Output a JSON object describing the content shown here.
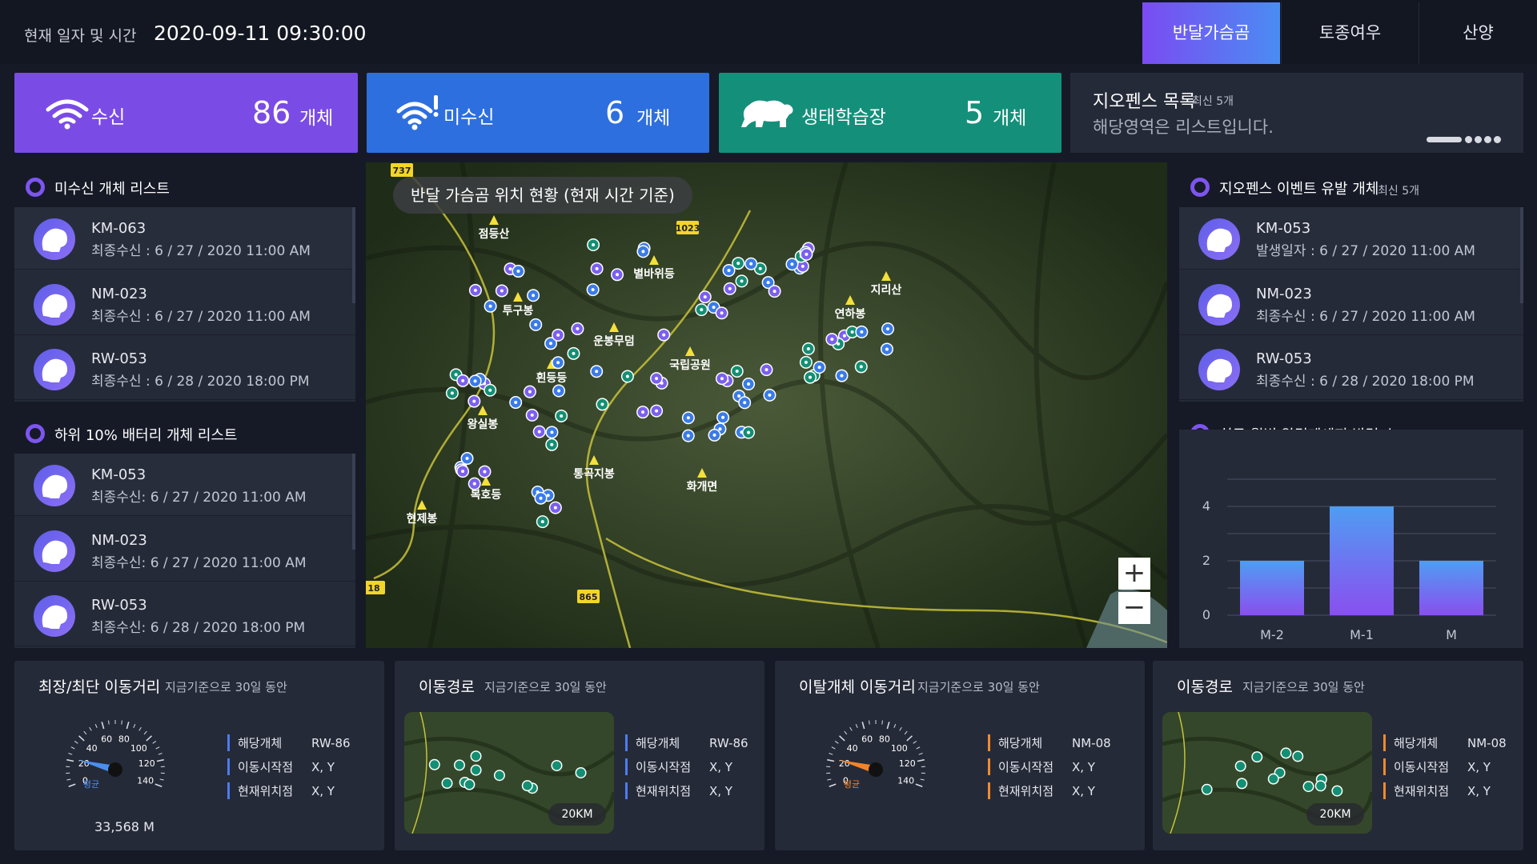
{
  "header": {
    "datetime_label": "현재 일자 및 시간",
    "datetime_value": "2020-09-11 09:30:00",
    "tabs": [
      {
        "label": "반달가슴곰",
        "active": true
      },
      {
        "label": "토종여우",
        "active": false
      },
      {
        "label": "산양",
        "active": false
      }
    ]
  },
  "stats": [
    {
      "icon": "wifi-icon",
      "label": "수신",
      "value": "86",
      "unit": "개체",
      "color": "#7b4be6"
    },
    {
      "icon": "wifi-alert-icon",
      "label": "미수신",
      "value": "6",
      "unit": "개체",
      "color": "#2e6fdf"
    },
    {
      "icon": "bear-icon",
      "label": "생태학습장",
      "value": "5",
      "unit": "개체",
      "color": "#14907a"
    }
  ],
  "geofence_card": {
    "title": "지오펜스 목록",
    "subtitle": "최신 5개",
    "description": "해당영역은 리스트입니다."
  },
  "unreceived": {
    "title": "미수신 개체 리스트",
    "items": [
      {
        "id": "KM-063",
        "date": "최종수신 : 6 / 27 / 2020   11:00 AM"
      },
      {
        "id": "NM-023",
        "date": "최종수신 : 6 / 27 / 2020   11:00 AM"
      },
      {
        "id": "RW-053",
        "date": "최종수신 :  6 / 28 / 2020   18:00 PM"
      }
    ]
  },
  "low_battery": {
    "title": "하위 10% 배터리 개체 리스트",
    "items": [
      {
        "id": "KM-053",
        "date": "최종수신: 6 / 27 / 2020   11:00 AM"
      },
      {
        "id": "NM-023",
        "date": "최종수신: 6 / 27 / 2020   11:00 AM"
      },
      {
        "id": "RW-053",
        "date": "최종수신: 6 / 28 / 2020   18:00 PM"
      }
    ]
  },
  "geofence_events": {
    "title": "지오펜스 이벤트 유발 개체",
    "subtitle": "최신 5개",
    "items": [
      {
        "id": "KM-053",
        "date": "발생일자 :  6 / 27 / 2020   11:00 AM"
      },
      {
        "id": "NM-023",
        "date": "최종수신 : 6 / 27 / 2020   11:00 AM"
      },
      {
        "id": "RW-053",
        "date": "최종수신 :  6 / 28 / 2020   18:00 PM"
      }
    ]
  },
  "map": {
    "title": "반달 가슴곰 위치 현황 (현재 시간 기준)",
    "zoom_in": "+",
    "zoom_out": "−",
    "places": [
      "점등산",
      "별바위등",
      "지리산",
      "연하봉",
      "투구봉",
      "운봉무덤",
      "국립공원",
      "흰등등",
      "왕실봉",
      "통곡지봉",
      "화개면",
      "복호등",
      "현제봉"
    ],
    "roads": [
      "737",
      "1023",
      "865",
      "18"
    ]
  },
  "chart_panel": {
    "title": "최근 월별 알림메세지 발령 수"
  },
  "chart_data": {
    "type": "bar",
    "categories": [
      "M-2",
      "M-1",
      "M"
    ],
    "values": [
      2,
      4,
      2
    ],
    "yticks": [
      "0",
      "2",
      "4"
    ],
    "ylim": [
      0,
      5
    ]
  },
  "bottom": [
    {
      "title": "최장/최단 이동거리",
      "subtitle": "지금기준으로 30일 동안",
      "kind": "speedo",
      "distance": "33,568 M",
      "avg_label": "평균",
      "accent": "blue",
      "ticks": [
        "0",
        "20",
        "40",
        "60",
        "80",
        "100",
        "120",
        "140"
      ],
      "rows": [
        {
          "k": "해당개체",
          "v": "RW-86"
        },
        {
          "k": "이동시작점",
          "v": "X, Y"
        },
        {
          "k": "현재위치점",
          "v": "X, Y"
        }
      ]
    },
    {
      "title": "이동경로",
      "subtitle": "지금기준으로 30일 동안",
      "kind": "map",
      "scale": "20KM",
      "accent": "blue",
      "rows": [
        {
          "k": "해당개체",
          "v": "RW-86"
        },
        {
          "k": "이동시작점",
          "v": "X, Y"
        },
        {
          "k": "현재위치점",
          "v": "X, Y"
        }
      ]
    },
    {
      "title": "이탈개체 이동거리",
      "subtitle": "지금기준으로 30일 동안",
      "kind": "speedo",
      "avg_label": "평균",
      "accent": "orange",
      "ticks": [
        "0",
        "20",
        "40",
        "60",
        "80",
        "100",
        "120",
        "140"
      ],
      "rows": [
        {
          "k": "해당개체",
          "v": "NM-08"
        },
        {
          "k": "이동시작점",
          "v": "X, Y"
        },
        {
          "k": "현재위치점",
          "v": "X, Y"
        }
      ]
    },
    {
      "title": "이동경로",
      "subtitle": "지금기준으로 30일 동안",
      "kind": "map",
      "scale": "20KM",
      "accent": "orange",
      "rows": [
        {
          "k": "해당개체",
          "v": "NM-08"
        },
        {
          "k": "이동시작점",
          "v": "X, Y"
        },
        {
          "k": "현재위치점",
          "v": "X, Y"
        }
      ]
    }
  ]
}
